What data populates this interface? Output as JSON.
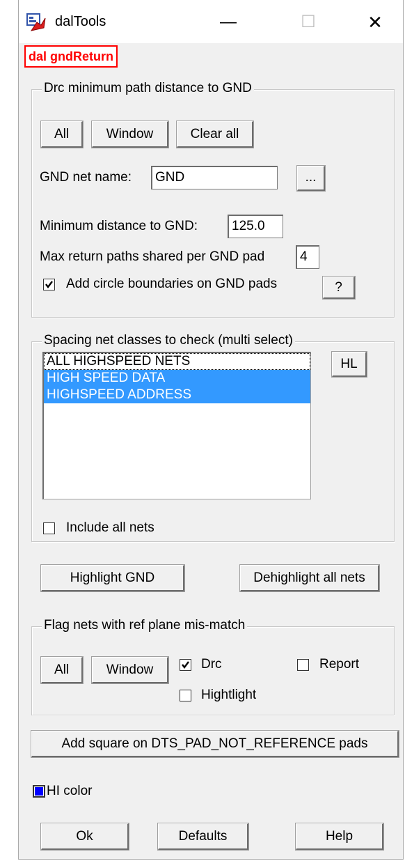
{
  "window": {
    "title": "dalTools",
    "minimize": "—",
    "maximize": "☐",
    "close": "✕"
  },
  "header_tag": "dal gndReturn",
  "drc_group": {
    "legend": "Drc minimum path distance to GND",
    "btn_all": "All",
    "btn_window": "Window",
    "btn_clear_all": "Clear all",
    "gnd_net_label": "GND net name:",
    "gnd_net_value": "GND",
    "browse_btn": "...",
    "min_dist_label": "Minimum distance to GND:",
    "min_dist_value": "125.0",
    "max_paths_label": "Max return paths shared per GND pad",
    "max_paths_value": "4",
    "circle_label": "Add circle boundaries on GND pads",
    "circle_checked": true,
    "help_btn": "?"
  },
  "spacing_group": {
    "legend": "Spacing net classes to check (multi select)",
    "items": [
      {
        "label": "ALL HIGHSPEED NETS",
        "selected": false
      },
      {
        "label": "HIGH SPEED DATA",
        "selected": true
      },
      {
        "label": "HIGHSPEED ADDRESS",
        "selected": true
      }
    ],
    "hl_btn": "HL",
    "include_all_label": "Include all nets",
    "include_all_checked": false
  },
  "highlight_gnd_btn": "Highlight GND",
  "dehighlight_btn": "Dehighlight all nets",
  "flag_group": {
    "legend": "Flag nets with ref plane mis-match",
    "btn_all": "All",
    "btn_window": "Window",
    "drc_label": "Drc",
    "drc_checked": true,
    "report_label": "Report",
    "report_checked": false,
    "highlight_label": "Hightlight",
    "highlight_checked": false
  },
  "add_square_btn": "Add square on DTS_PAD_NOT_REFERENCE pads",
  "hi_color_label": "HI color",
  "colors": {
    "hi_color": "#0000ff",
    "selection": "#3399ff",
    "tag_red": "#ff0000"
  },
  "footer": {
    "ok": "Ok",
    "defaults": "Defaults",
    "help": "Help"
  }
}
